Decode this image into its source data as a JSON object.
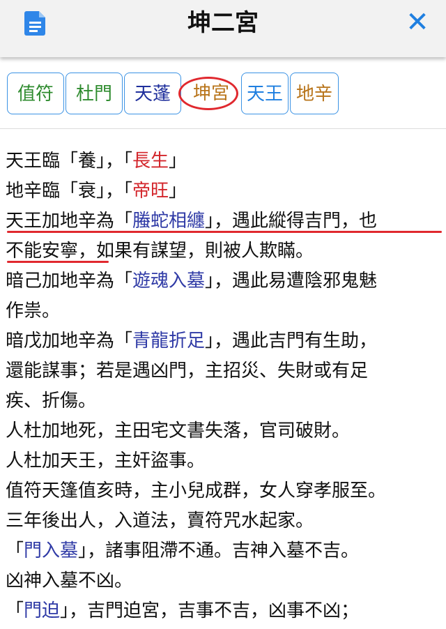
{
  "header": {
    "title": "坤二宮",
    "doc_icon": "document-icon",
    "close_icon": "close-icon",
    "close_symbol": "✕",
    "accent_color": "#1f7fe0"
  },
  "tabs": [
    {
      "label": "值符",
      "color": "#2e8b2e"
    },
    {
      "label": "杜門",
      "color": "#2e8b2e"
    },
    {
      "label": "天蓬",
      "color": "#1f2f9c"
    },
    {
      "label": "坤宮",
      "color": "#b8741a",
      "highlighted": true
    },
    {
      "label": "天王",
      "color": "#1f7fe0"
    },
    {
      "label": "地辛",
      "color": "#b8741a"
    }
  ],
  "content": {
    "l1": {
      "a": "天王臨「養」，「",
      "r": "長生",
      "b": "」"
    },
    "l2": {
      "a": "地辛臨「衰」，「",
      "r": "帝旺",
      "b": "」"
    },
    "l3": {
      "a": "天王加地辛為「",
      "k": "螣蛇相纏",
      "b": "」，遇此縱得吉門，也"
    },
    "l4": {
      "a": "不能安寧，如果有謀望，則被人欺瞞。"
    },
    "l5": {
      "a": "暗己加地辛為「",
      "k": "遊魂入墓",
      "b": "」，遇此易遭陰邪鬼魅"
    },
    "l6": {
      "a": "作祟。"
    },
    "l7": {
      "a": "暗戊加地辛為「",
      "k": "青龍折足",
      "b": "」，遇此吉門有生助，"
    },
    "l8": {
      "a": "還能謀事；若是遇凶門，主招災、失財或有足"
    },
    "l9": {
      "a": "疾、折傷。"
    },
    "l10": {
      "a": "人杜加地死，主田宅文書失落，官司破財。"
    },
    "l11": {
      "a": "人杜加天王，主奸盜事。"
    },
    "l12": {
      "a": "值符天篷值亥時，主小兒成群，女人穿孝服至。"
    },
    "l13": {
      "a": "三年後出人，入道法，賣符咒水起家。"
    },
    "l14": {
      "a": "「",
      "k": "門入墓",
      "b": "」，諸事阻滯不通。吉神入墓不吉。"
    },
    "l15": {
      "a": "凶神入墓不凶。"
    },
    "l16": {
      "a": "「",
      "k": "門迫",
      "b": "」，吉門迫宮，吉事不吉，凶事不凶；"
    }
  }
}
